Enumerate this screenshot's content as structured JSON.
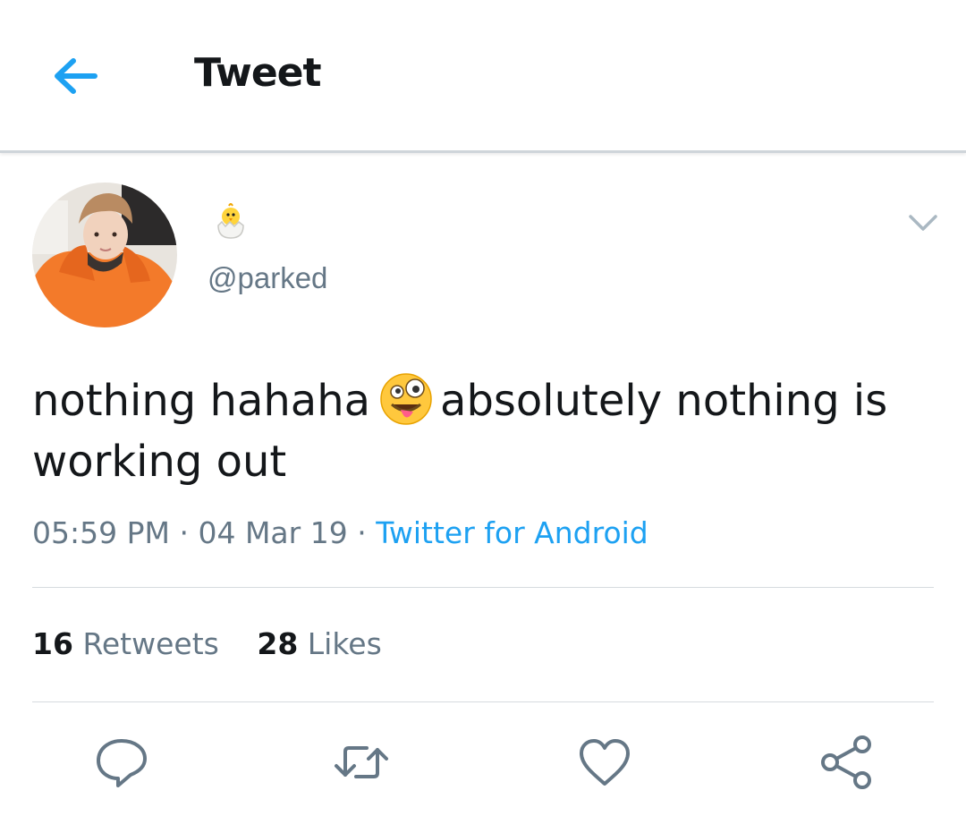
{
  "header": {
    "title": "Tweet",
    "back_icon": "arrow-left-icon",
    "accent": "#1da1f2"
  },
  "tweet": {
    "display_name_icon": "hatching-chick-emoji",
    "handle": "@parked",
    "text_part1": "nothing hahaha",
    "text_emoji": "zany-face-emoji",
    "text_part2": "absolutely nothing is working out",
    "time": "05:59 PM",
    "date": "04 Mar 19",
    "source": "Twitter for Android",
    "separator": "·"
  },
  "stats": {
    "retweets_count": "16",
    "retweets_label": "Retweets",
    "likes_count": "28",
    "likes_label": "Likes"
  },
  "actions": [
    "reply-icon",
    "retweet-icon",
    "like-icon",
    "share-icon"
  ],
  "colors": {
    "text": "#14171a",
    "muted": "#657786",
    "link": "#1da1f2",
    "icon": "#657786"
  }
}
